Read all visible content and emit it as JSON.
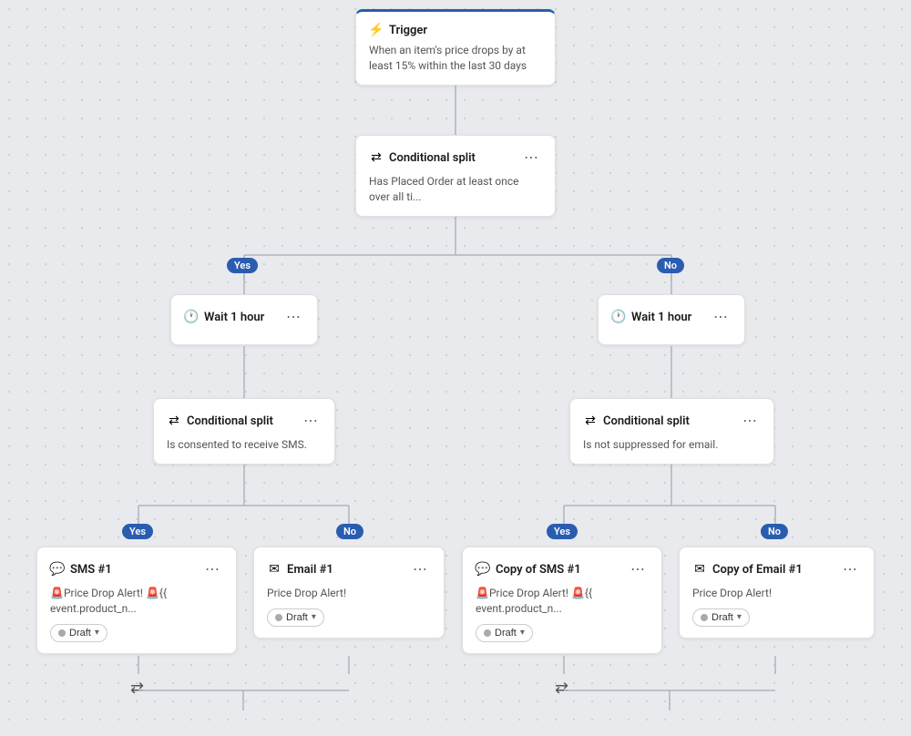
{
  "trigger": {
    "title": "Trigger",
    "body": "When an item's price drops by at least 15% within the last 30 days"
  },
  "conditional_split_1": {
    "title": "Conditional split",
    "body": "Has Placed Order at least once over all ti..."
  },
  "yes_badge_1": "Yes",
  "no_badge_1": "No",
  "wait_1": {
    "title": "Wait 1 hour"
  },
  "wait_2": {
    "title": "Wait 1 hour"
  },
  "conditional_split_2": {
    "title": "Conditional split",
    "body": "Is consented to receive SMS."
  },
  "conditional_split_3": {
    "title": "Conditional split",
    "body": "Is not suppressed for email."
  },
  "yes_badge_2": "Yes",
  "no_badge_2": "No",
  "yes_badge_3": "Yes",
  "no_badge_3": "No",
  "sms1": {
    "title": "SMS #1",
    "body": "🚨Price Drop Alert! 🚨{{ event.product_n..."
  },
  "email1": {
    "title": "Email #1",
    "body": "Price Drop Alert!"
  },
  "sms2": {
    "title": "Copy of SMS #1",
    "body": "🚨Price Drop Alert! 🚨{{ event.product_n..."
  },
  "email2": {
    "title": "Copy of Email #1",
    "body": "Price Drop Alert!"
  },
  "draft_label": "Draft",
  "more_icon": "⋯"
}
